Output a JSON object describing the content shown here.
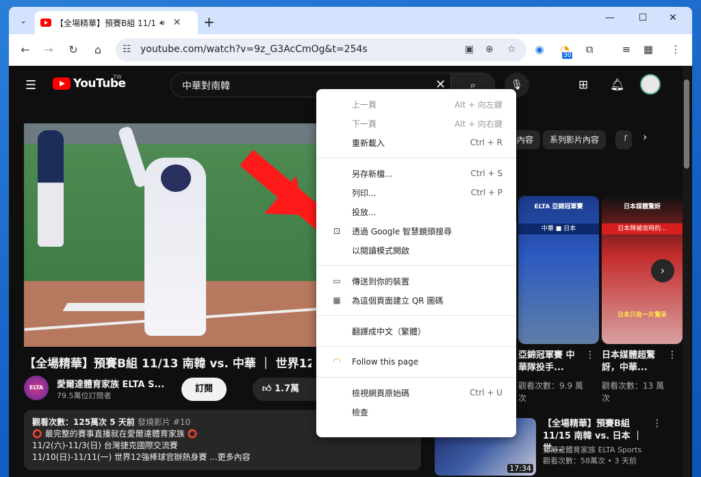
{
  "browser": {
    "tab_title": "【全場精華】預賽B組 11/1",
    "url": "youtube.com/watch?v=9z_G3AcCmOg&t=254s",
    "extension_badge": "30"
  },
  "youtube": {
    "logo": "YouTube",
    "region": "TW",
    "search_query": "中華對南韓",
    "video_title": "【全場精華】預賽B組 11/13 南韓 vs. 中華 ｜ 世界12",
    "channel_name": "愛爾達體育家族 ELTA S...",
    "channel_avatar_text": "ELTA",
    "subscribers": "79.5萬位訂閱者",
    "subscribe_label": "訂閱",
    "likes": "1.7萬",
    "description": {
      "views_line": "觀看次數：125萬次  5 天前",
      "tag": "發燒影片 #10",
      "line2": "最完整的賽事直播就在愛爾達體育家族",
      "line3": "11/2(六)-11/3(日) 台灣捷克國際交流賽",
      "line4": "11/10(日)-11/11(一) 世界12強棒球官辦熱身賽 ...更多內容"
    },
    "chips": [
      "果內容",
      "系列影片內容",
      "「"
    ],
    "cards": [
      {
        "title": "亞錦冠軍賽 中華隊投手...",
        "views": "觀看次數：9.9 萬次",
        "thumb_text": "ELTA 亞錦冠軍賽",
        "band": "中華 ■ 日本"
      },
      {
        "title": "日本媒體超驚訝，中華...",
        "views": "觀看次數：13 萬次",
        "thumb_text": "日本媒體驚訝",
        "band": "日本隊被攻時的...",
        "caption": "日本只有一片驚呆"
      }
    ],
    "related": {
      "title": "【全場精華】預賽B組 11/15 南韓 vs. 日本 ｜ 世...",
      "channel": "愛爾達體育家族 ELTA Sports",
      "meta": "觀看次數：58萬次 • 3 天前",
      "duration": "17:34"
    }
  },
  "context_menu": {
    "items": [
      {
        "label": "上一頁",
        "shortcut": "Alt + 向左鍵"
      },
      {
        "label": "下一頁",
        "shortcut": "Alt + 向右鍵"
      },
      {
        "label": "重新載入",
        "shortcut": "Ctrl + R"
      },
      {
        "label": "另存新檔...",
        "shortcut": "Ctrl + S"
      },
      {
        "label": "列印...",
        "shortcut": "Ctrl + P"
      },
      {
        "label": "投放...",
        "shortcut": ""
      },
      {
        "label": "透過 Google 智慧鏡頭搜尋",
        "shortcut": ""
      },
      {
        "label": "以閱讀模式開啟",
        "shortcut": ""
      },
      {
        "label": "傳送到你的裝置",
        "shortcut": ""
      },
      {
        "label": "為這個頁面建立 QR 圖碼",
        "shortcut": ""
      },
      {
        "label": "翻譯成中文（繁體）",
        "shortcut": ""
      },
      {
        "label": "Follow this page",
        "shortcut": ""
      },
      {
        "label": "檢視網頁原始碼",
        "shortcut": "Ctrl + U"
      },
      {
        "label": "檢查",
        "shortcut": ""
      }
    ]
  }
}
